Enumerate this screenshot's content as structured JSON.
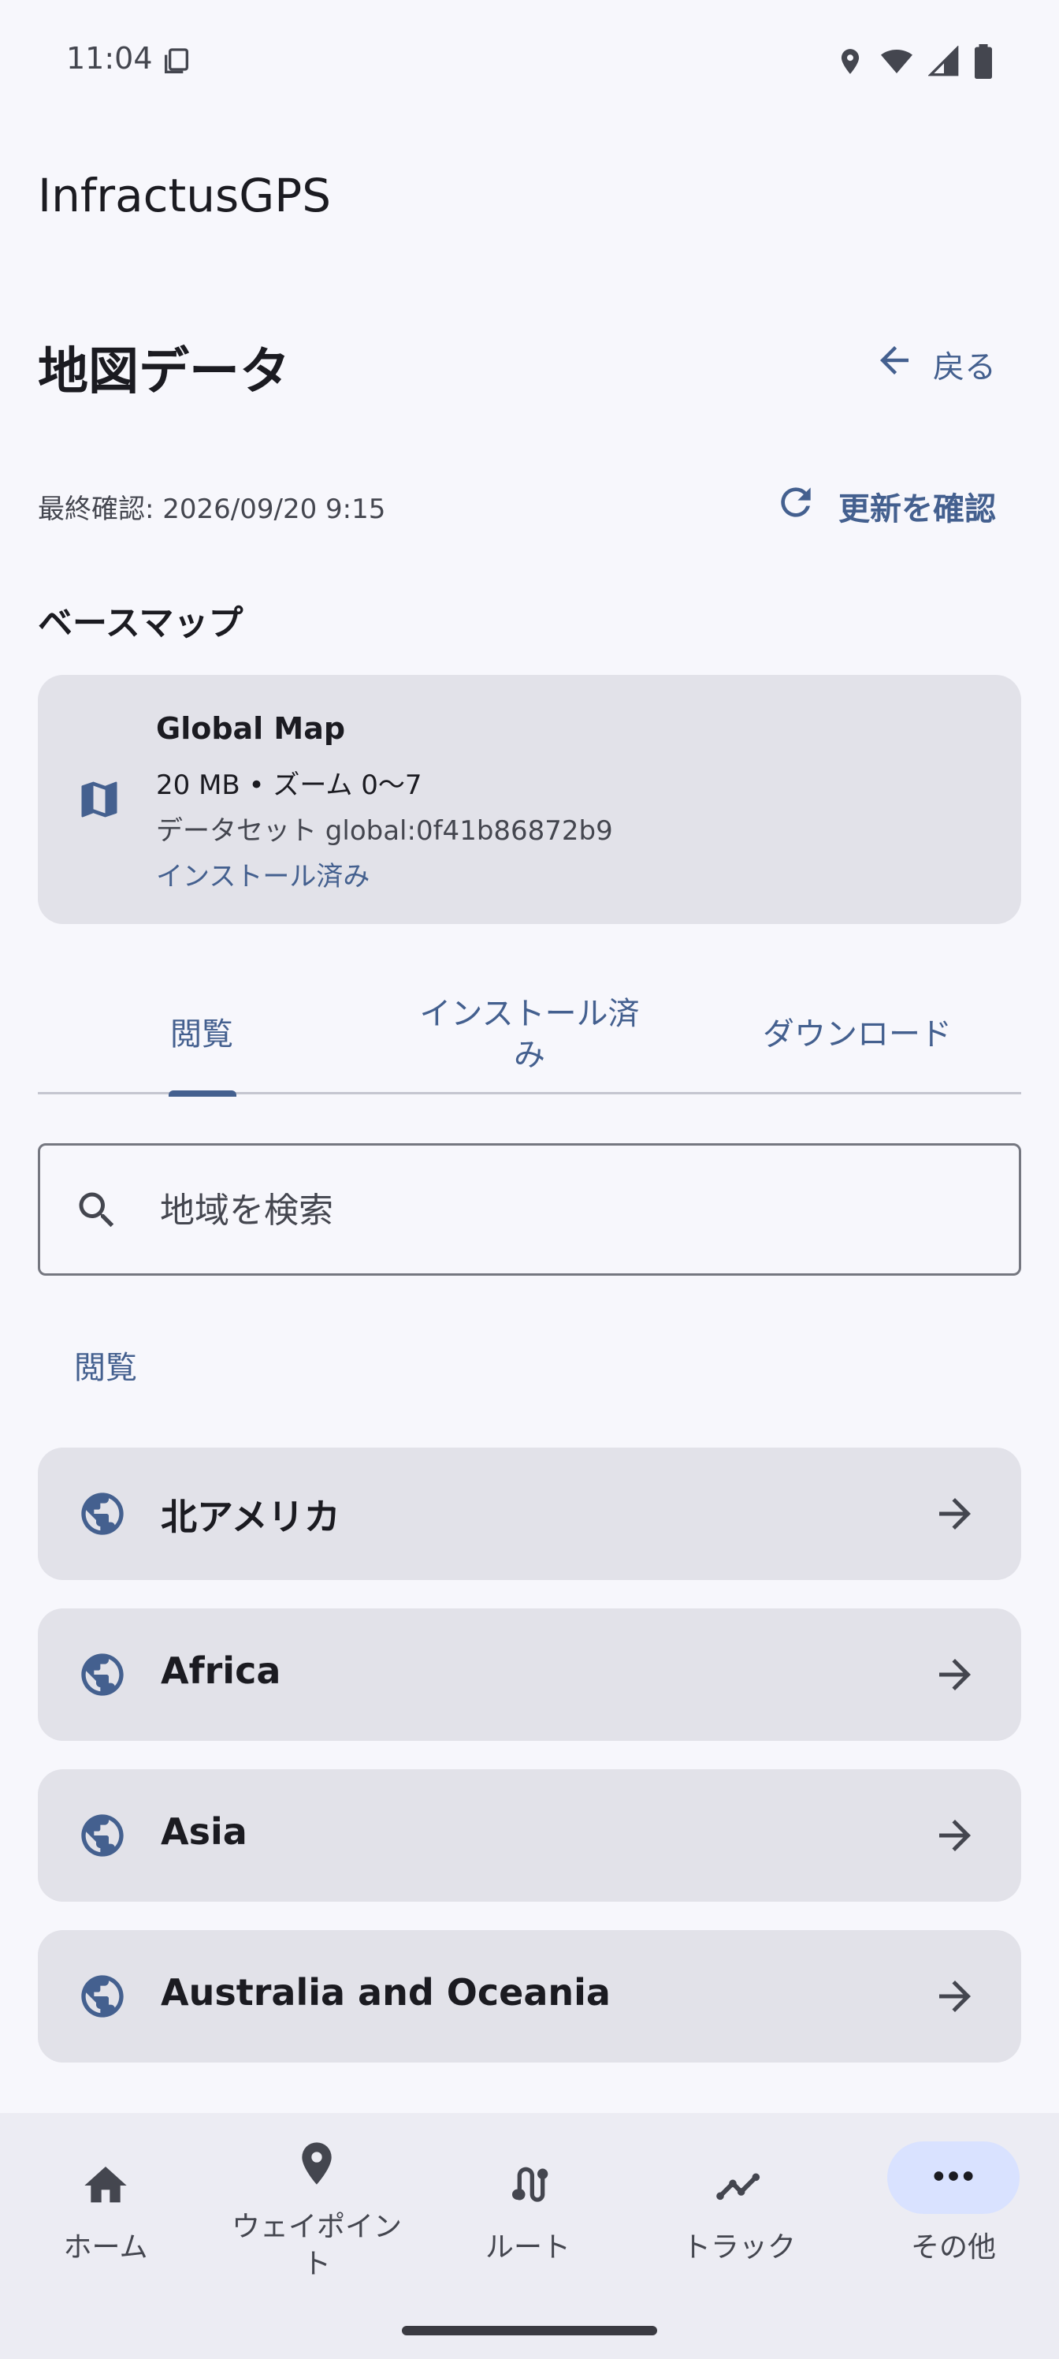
{
  "status_bar": {
    "time": "11:04"
  },
  "app": {
    "title": "InfractusGPS"
  },
  "header": {
    "title": "地図データ",
    "back_label": "戻る"
  },
  "update": {
    "last_checked": "最終確認: 2026/09/20 9:15",
    "check_label": "更新を確認"
  },
  "basemap": {
    "section_title": "ベースマップ",
    "name": "Global Map",
    "size": "20 MB • ズーム 0〜7",
    "dataset": "データセット global:0f41b86872b9",
    "status": "インストール済み"
  },
  "tabs": [
    {
      "label": "閲覧",
      "selected": true
    },
    {
      "label": "インストール済み",
      "selected": false
    },
    {
      "label": "ダウンロード",
      "selected": false
    }
  ],
  "search": {
    "placeholder": "地域を検索",
    "value": ""
  },
  "browse": {
    "section_label": "閲覧",
    "regions": [
      {
        "label": "北アメリカ",
        "icon": "globe-icon"
      },
      {
        "label": "Africa",
        "icon": "globe-icon"
      },
      {
        "label": "Asia",
        "icon": "globe-icon"
      },
      {
        "label": "Australia and Oceania",
        "icon": "globe-icon"
      }
    ]
  },
  "bottom_nav": [
    {
      "label": "ホーム",
      "icon": "home-icon",
      "active": false
    },
    {
      "label": "ウェイポイント",
      "icon": "location-pin-icon",
      "active": false
    },
    {
      "label": "ルート",
      "icon": "route-icon",
      "active": false
    },
    {
      "label": "トラック",
      "icon": "track-icon",
      "active": false
    },
    {
      "label": "その他",
      "icon": "more-icon",
      "active": true
    }
  ],
  "colors": {
    "accent": "#44608f",
    "card": "#e2e2e9",
    "background": "#f7f7fc",
    "active_pill": "#d9e2ff"
  }
}
